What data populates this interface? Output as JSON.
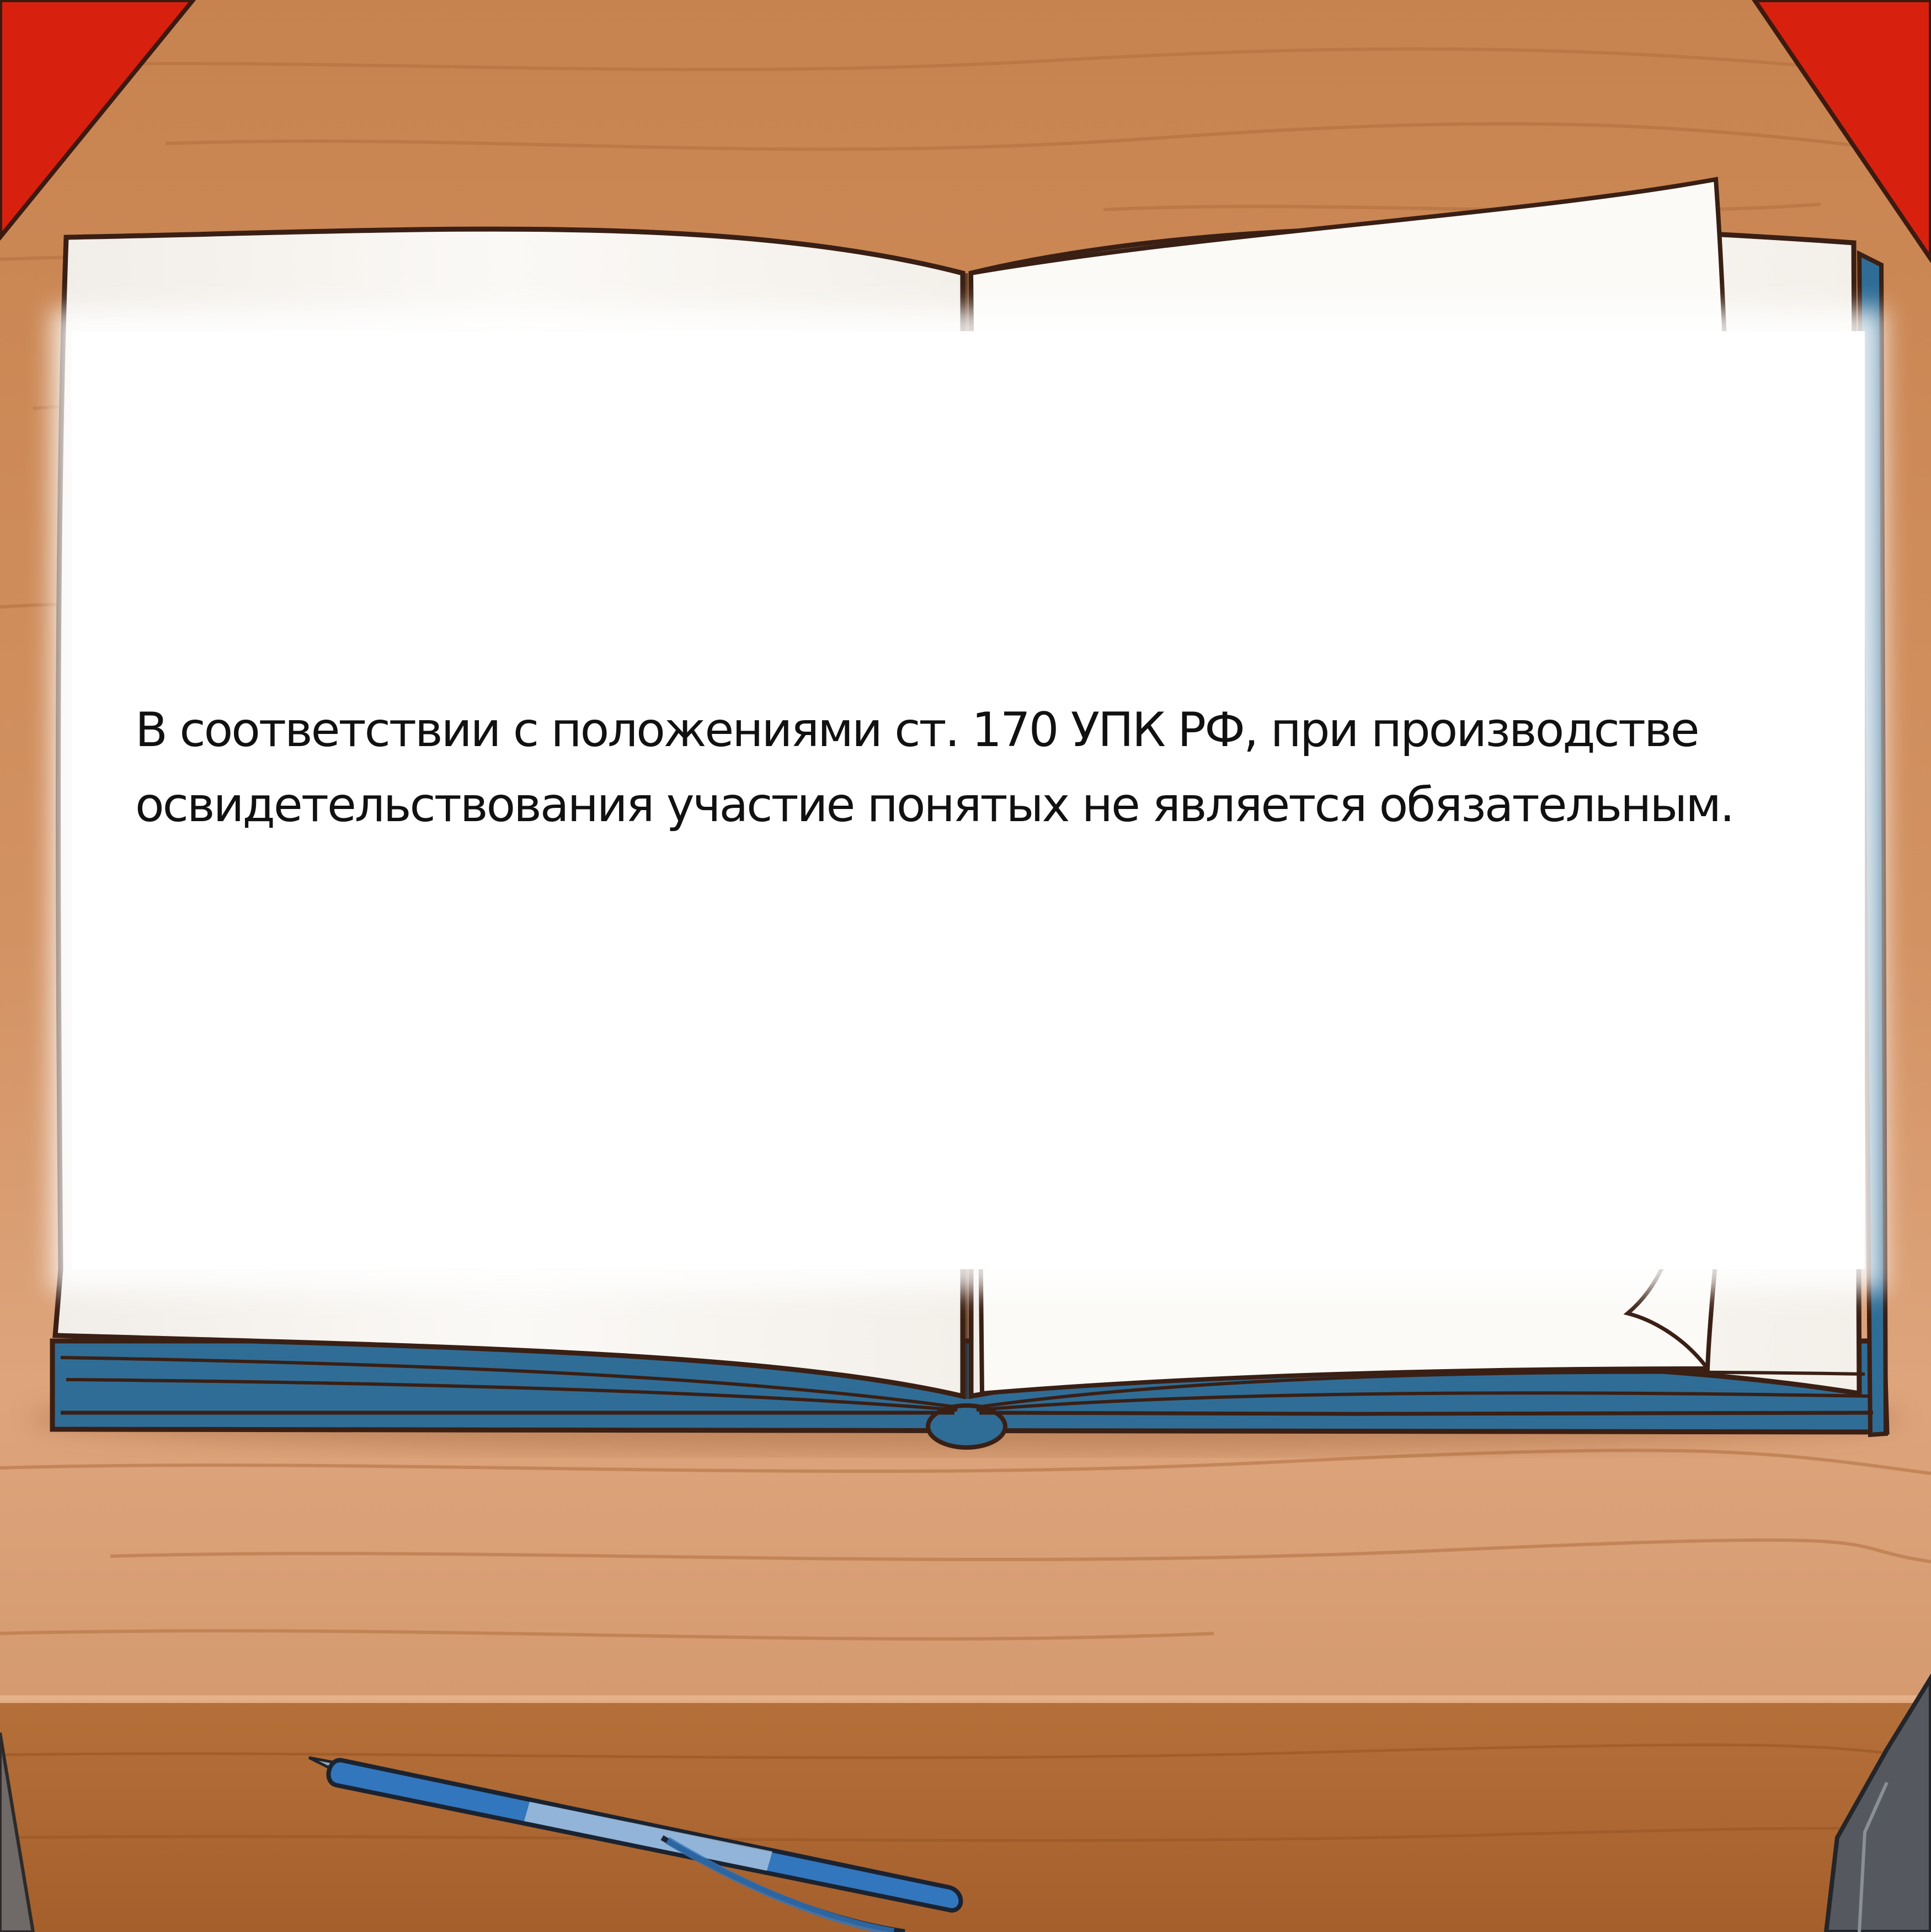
{
  "page": {
    "text_lines": [
      "В соответствии с положениями ст. 170 УПК РФ, при производстве",
      "освидетельствования участие понятых не является обязательным."
    ]
  },
  "colors": {
    "desk": "#c9834f",
    "desk_front": "#b06a35",
    "red_binder": "#d92010",
    "book_cover": "#2f6d96",
    "paper": "#ffffff",
    "outline": "#4a2518",
    "pen_body": "#2f72b8"
  },
  "icons": {
    "book": "open-book-illustration",
    "pen": "ballpoint-pen-illustration",
    "binder": "red-binder-illustration",
    "phone": "phone-corner-illustration"
  }
}
